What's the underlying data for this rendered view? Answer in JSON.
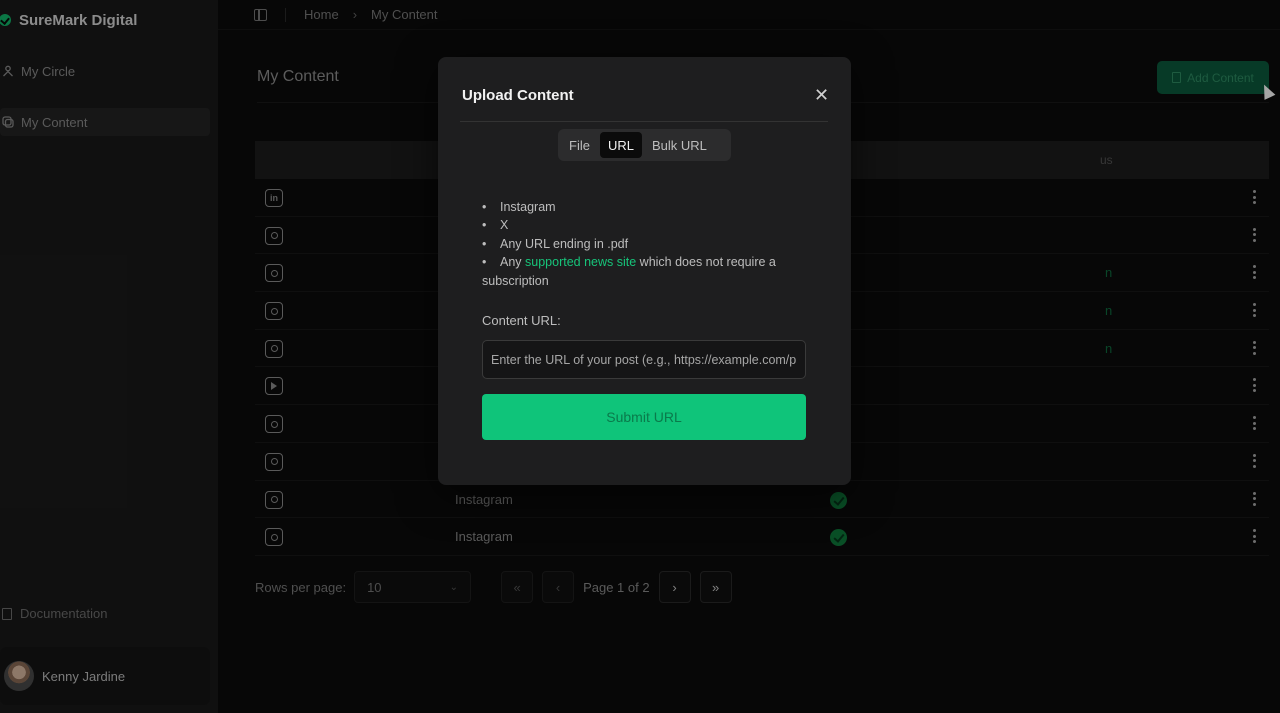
{
  "brand": {
    "name": "SureMark Digital"
  },
  "sidebar": {
    "items": [
      {
        "label": "My Circle"
      },
      {
        "label": "My Content"
      }
    ],
    "documentation": "Documentation",
    "user": {
      "name": "Kenny Jardine"
    }
  },
  "breadcrumb": {
    "home": "Home",
    "current": "My Content"
  },
  "main": {
    "title": "My Content",
    "add_button": "Add Content",
    "table": {
      "status_header_fragment": "us",
      "rows": [
        {
          "icon": "linkedin-icon",
          "platform": "",
          "status": "",
          "status_hint": ""
        },
        {
          "icon": "instagram-icon",
          "platform": "",
          "status": "",
          "status_hint": ""
        },
        {
          "icon": "instagram-icon",
          "platform": "",
          "status": "",
          "status_hint": "n"
        },
        {
          "icon": "instagram-icon",
          "platform": "",
          "status": "",
          "status_hint": "n"
        },
        {
          "icon": "instagram-icon",
          "platform": "",
          "status": "",
          "status_hint": "n"
        },
        {
          "icon": "youtube-icon",
          "platform": "",
          "status": "",
          "status_hint": ""
        },
        {
          "icon": "instagram-icon",
          "platform": "",
          "status": "",
          "status_hint": ""
        },
        {
          "icon": "instagram-icon",
          "platform": "",
          "status": "",
          "status_hint": ""
        },
        {
          "icon": "instagram-icon",
          "platform": "Instagram",
          "status": "verified",
          "status_hint": ""
        },
        {
          "icon": "instagram-icon",
          "platform": "Instagram",
          "status": "verified",
          "status_hint": ""
        }
      ]
    },
    "pagination": {
      "rows_per_page_label": "Rows per page:",
      "rows_per_page_value": "10",
      "page_info": "Page 1 of 2"
    }
  },
  "modal": {
    "title": "Upload Content",
    "tabs": [
      {
        "label": "File",
        "active": false
      },
      {
        "label": "URL",
        "active": true
      },
      {
        "label": "Bulk URL",
        "active": false
      }
    ],
    "supported": {
      "item1": "Instagram",
      "item2": "X",
      "item3": "Any URL ending in .pdf",
      "item4_prefix": "Any ",
      "item4_link": "supported news site",
      "item4_suffix": " which does not require a",
      "item4_cont": "subscription"
    },
    "field_label": "Content URL:",
    "input_placeholder": "Enter the URL of your post (e.g., https://example.com/p",
    "submit_label": "Submit URL"
  },
  "colors": {
    "accent": "#0fc47a",
    "accent_dark": "#0c5a3d",
    "background": "#0b0b0b"
  }
}
